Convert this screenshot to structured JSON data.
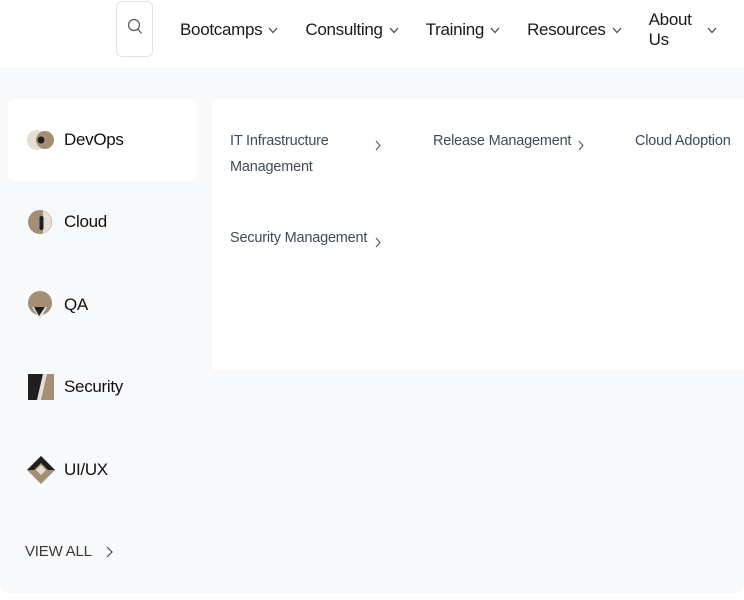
{
  "header": {
    "search_icon": "search-icon",
    "nav": [
      {
        "label": "Bootcamps"
      },
      {
        "label": "Consulting"
      },
      {
        "label": "Training"
      },
      {
        "label": "Resources"
      },
      {
        "label": "About Us"
      }
    ]
  },
  "sidebar": {
    "items": [
      {
        "label": "DevOps",
        "icon": "devops-icon",
        "active": true
      },
      {
        "label": "Cloud",
        "icon": "cloud-icon",
        "active": false
      },
      {
        "label": "QA",
        "icon": "qa-icon",
        "active": false
      },
      {
        "label": "Security",
        "icon": "security-icon",
        "active": false
      },
      {
        "label": "UI/UX",
        "icon": "uiux-icon",
        "active": false
      }
    ],
    "view_all": "VIEW ALL"
  },
  "content": {
    "links": [
      {
        "label": "IT Infrastructure Management"
      },
      {
        "label": "Release Management"
      },
      {
        "label": "Cloud Adoption"
      },
      {
        "label": "Security Management"
      }
    ]
  },
  "colors": {
    "panel_bg": "#f8f9fb",
    "icon_tan": "#a48e76",
    "icon_dark": "#1f1f1f",
    "link_text": "#3f4a5a"
  }
}
